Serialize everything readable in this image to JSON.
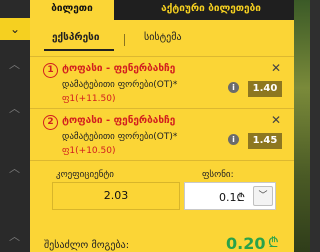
{
  "tabs": {
    "active": "ბილეთი",
    "other": "აქტიური ბილეთები"
  },
  "subtabs": {
    "express": "ექსპრესი",
    "system": "სისტემა"
  },
  "bets": [
    {
      "num": "1",
      "title": "ტოფასი - ფენერბახჩე",
      "market": "დამატებითი ფორები(OT)*",
      "selection": "ფ1(+11.50)",
      "odds": "1.40"
    },
    {
      "num": "2",
      "title": "ტოფასი - ფენერბახჩე",
      "market": "დამატებითი ფორები(OT)*",
      "selection": "ფ1(+10.50)",
      "odds": "1.45"
    }
  ],
  "coef": {
    "label": "კოეფიციენტი",
    "value": "2.03"
  },
  "stake": {
    "label": "ფსონი:",
    "value": "0.1₾"
  },
  "payout": {
    "label": "შესაძლო მოგება:",
    "value": "0.20"
  },
  "colors": {
    "accent": "#fbd536",
    "red": "#d21f1f",
    "green": "#2aa24a",
    "odds_bg": "#8d7720"
  }
}
